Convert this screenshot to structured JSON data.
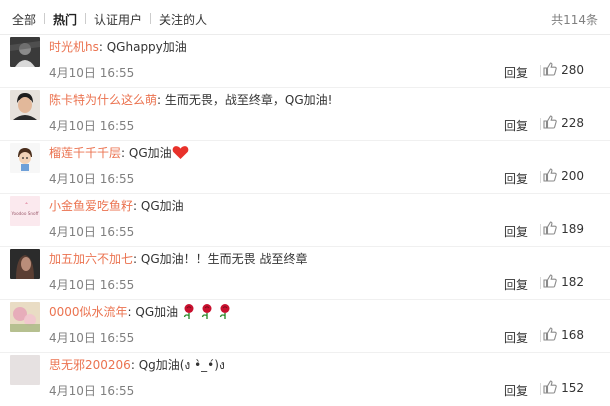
{
  "filter": {
    "tabs": [
      {
        "label": "全部"
      },
      {
        "label": "热门"
      },
      {
        "label": "认证用户"
      },
      {
        "label": "关注的人"
      }
    ],
    "total": "共114条"
  },
  "comments": [
    {
      "user": "时光机hs",
      "colon": ":",
      "text": "QGhappy加油",
      "time": "4月10日 16:55",
      "reply": "回复",
      "likes": "280"
    },
    {
      "user": "陈卡特为什么这么萌",
      "colon": ":",
      "text": "生而无畏，战至终章，QG加油!",
      "time": "4月10日 16:55",
      "reply": "回复",
      "likes": "228"
    },
    {
      "user": "榴莲千千千层",
      "colon": ":",
      "text": "QG加油",
      "time": "4月10日 16:55",
      "reply": "回复",
      "likes": "200",
      "emoji": "heart-icon"
    },
    {
      "user": "小金鱼爱吃鱼籽",
      "colon": ":",
      "text": "QG加油",
      "time": "4月10日 16:55",
      "reply": "回复",
      "likes": "189",
      "avatar_text": "Yoodoo Snoff"
    },
    {
      "user": "加五加六不加七",
      "colon": ":",
      "text": "QG加油！！生而无畏 战至终章",
      "time": "4月10日 16:55",
      "reply": "回复",
      "likes": "182"
    },
    {
      "user": "0000似水流年",
      "colon": ":",
      "text": "QG加油",
      "time": "4月10日 16:55",
      "reply": "回复",
      "likes": "168",
      "emoji": "rose-icon"
    },
    {
      "user": "思无邪200206",
      "colon": ":",
      "text": "Qg加油(ง •̀_•́)ง",
      "time": "4月10日 16:55",
      "reply": "回复",
      "likes": "152"
    }
  ],
  "colors": {
    "username": "#eb7350",
    "heart": "#e8312a",
    "rose": "#c8102e"
  }
}
